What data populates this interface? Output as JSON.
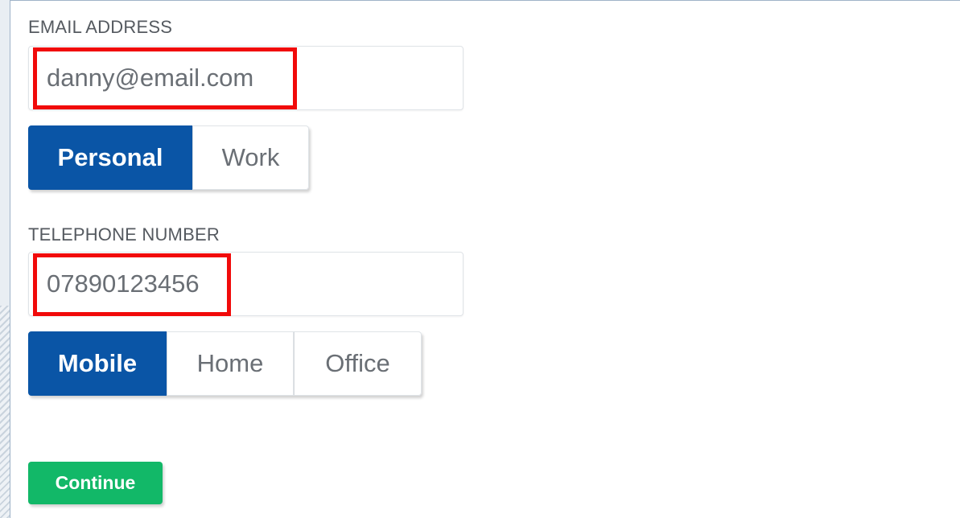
{
  "email": {
    "label": "EMAIL ADDRESS",
    "value": "danny@email.com",
    "type_options": [
      {
        "label": "Personal",
        "selected": true
      },
      {
        "label": "Work",
        "selected": false
      }
    ]
  },
  "telephone": {
    "label": "TELEPHONE NUMBER",
    "value": "07890123456",
    "type_options": [
      {
        "label": "Mobile",
        "selected": true
      },
      {
        "label": "Home",
        "selected": false
      },
      {
        "label": "Office",
        "selected": false
      }
    ]
  },
  "actions": {
    "continue_label": "Continue"
  },
  "colors": {
    "primary": "#0a55a6",
    "success": "#12b868",
    "highlight": "#f10a0a"
  }
}
